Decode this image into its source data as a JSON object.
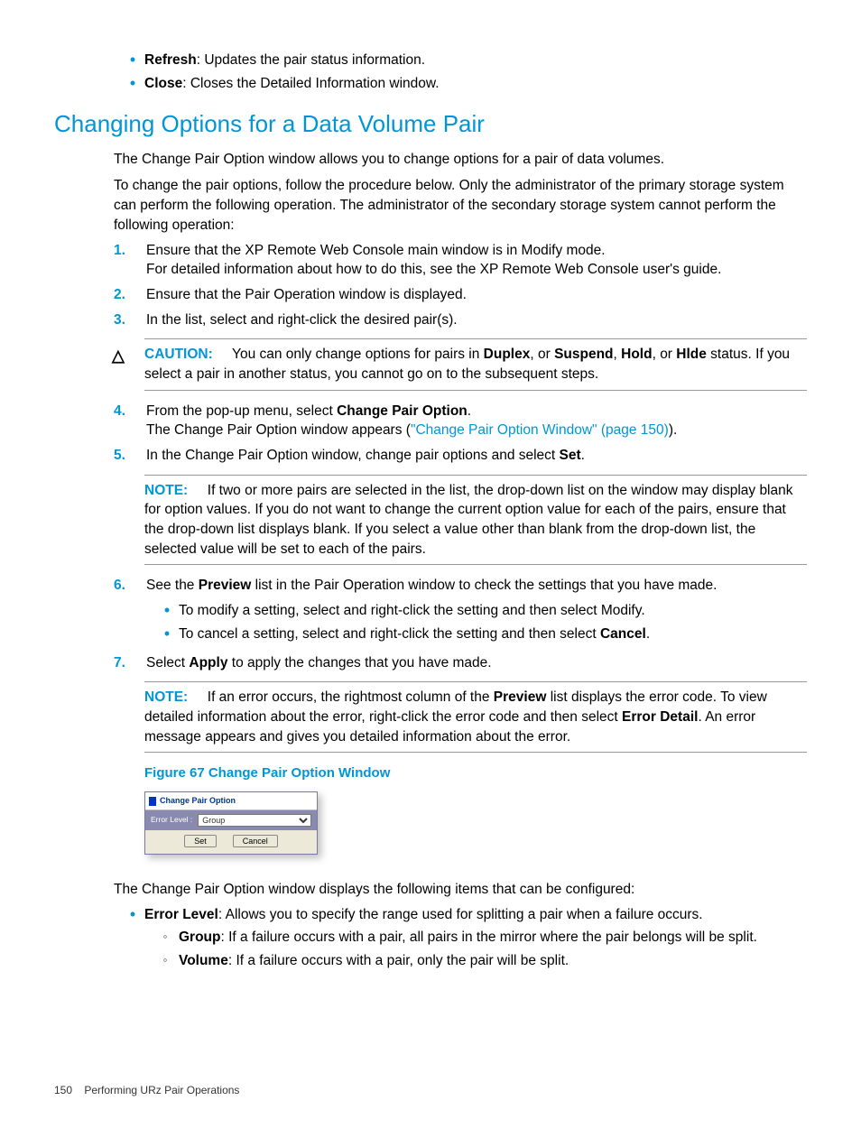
{
  "top_bullets": [
    {
      "term": "Refresh",
      "desc": ": Updates the pair status information."
    },
    {
      "term": "Close",
      "desc": ": Closes the Detailed Information window."
    }
  ],
  "heading": "Changing Options for a Data Volume Pair",
  "p1": "The Change Pair Option window allows you to change options for a pair of data volumes.",
  "p2": "To change the pair options, follow the procedure below. Only the administrator of the primary storage system can perform the following operation. The administrator of the secondary storage system cannot perform the following operation:",
  "step1a": "Ensure that the XP Remote Web Console main window is in Modify mode.",
  "step1b": "For detailed information about how to do this, see the XP Remote Web Console user's guide.",
  "step2": "Ensure that the Pair Operation window is displayed.",
  "step3": "In the list, select and right-click the desired pair(s).",
  "caution": {
    "label": "CAUTION:",
    "pre": "You can only change options for pairs in ",
    "b1": "Duplex",
    "mid1": ", or ",
    "b2": "Suspend",
    "mid2": ", ",
    "b3": "Hold",
    "mid3": ", or ",
    "b4": "Hlde",
    "post": " status. If you select a pair in another status, you cannot go on to the subsequent steps."
  },
  "step4a_pre": "From the pop-up menu, select ",
  "step4a_b": "Change Pair Option",
  "step4a_post": ".",
  "step4b_pre": "The Change Pair Option window appears (",
  "step4b_link": "\"Change Pair Option Window\" (page 150)",
  "step4b_post": ").",
  "step5_pre": "In the Change Pair Option window, change pair options and select ",
  "step5_b": "Set",
  "step5_post": ".",
  "note1": {
    "label": "NOTE:",
    "text": "If two or more pairs are selected in the list, the drop-down list on the window may display blank for option values. If you do not want to change the current option value for each of the pairs, ensure that the drop-down list displays blank. If you select a value other than blank from the drop-down list, the selected value will be set to each of the pairs."
  },
  "step6_pre": "See the ",
  "step6_b": "Preview",
  "step6_post": " list in the Pair Operation window to check the settings that you have made.",
  "step6_sub": [
    "To modify a setting, select and right-click the setting and then select Modify.",
    {
      "pre": "To cancel a setting, select and right-click the setting and then select ",
      "b": "Cancel",
      "post": "."
    }
  ],
  "step7_pre": "Select ",
  "step7_b": "Apply",
  "step7_post": " to apply the changes that you have made.",
  "note2": {
    "label": "NOTE:",
    "pre": "If an error occurs, the rightmost column of the ",
    "b1": "Preview",
    "mid1": " list displays the error code. To view detailed information about the error, right-click the error code and then select ",
    "b2": "Error Detail",
    "post": ". An error message appears and gives you detailed information about the error."
  },
  "figure_caption": "Figure 67 Change Pair Option Window",
  "window": {
    "title": "Change Pair Option",
    "field_label": "Error Level :",
    "field_value": "Group",
    "set_btn": "Set",
    "cancel_btn": "Cancel"
  },
  "p3": "The Change Pair Option window displays the following items that can be configured:",
  "err_bullet": {
    "term": "Error Level",
    "desc": ": Allows you to specify the range used for splitting a pair when a failure occurs."
  },
  "err_sub": [
    {
      "term": "Group",
      "desc": ": If a failure occurs with a pair, all pairs in the mirror where the pair belongs will be split."
    },
    {
      "term": "Volume",
      "desc": ": If a failure occurs with a pair, only the pair will be split."
    }
  ],
  "footer": {
    "page": "150",
    "section": "Performing URz Pair Operations"
  }
}
